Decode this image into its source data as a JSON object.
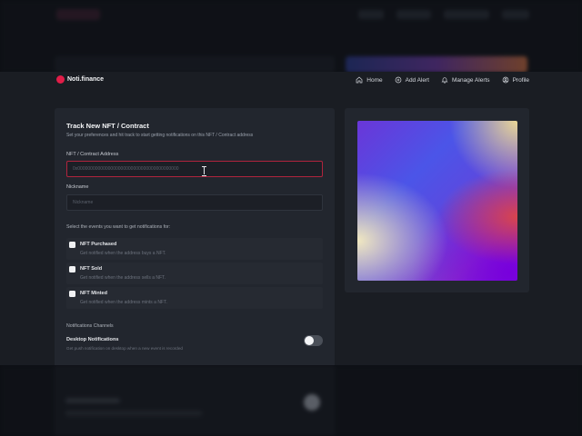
{
  "brand": {
    "name": "Noti.finance"
  },
  "nav": [
    {
      "label": "Home",
      "icon": "home-icon"
    },
    {
      "label": "Add Alert",
      "icon": "plus-circle-icon"
    },
    {
      "label": "Manage Alerts",
      "icon": "bell-icon"
    },
    {
      "label": "Profile",
      "icon": "user-circle-icon"
    }
  ],
  "form": {
    "title": "Track New NFT / Contract",
    "subtitle": "Set your preferences and hit track to start getting notifications on this NFT / Contract address",
    "address_label": "NFT / Contract Address",
    "address_placeholder": "0x0000000000000000000000000000000000000000",
    "nickname_label": "Nickname",
    "nickname_placeholder": "Nickname",
    "events_label": "Select the events you want to get notifications for:",
    "events": [
      {
        "title": "NFT Purchased",
        "description": "Get notified when the address buys a NFT.",
        "checked": false
      },
      {
        "title": "NFT Sold",
        "description": "Get notified when the address sells a NFT.",
        "checked": false
      },
      {
        "title": "NFT Minted",
        "description": "Get notified when the address mints a NFT.",
        "checked": false
      }
    ],
    "channels_label": "Notifications Channels",
    "desktop": {
      "title": "Desktop Notifications",
      "description": "Get push notification on desktop when a new event is recorded",
      "enabled": false
    }
  },
  "colors": {
    "brand_accent": "#e11d48",
    "focus_border": "#b0243d",
    "card_bg": "#22262e",
    "page_bg": "#1a1d23"
  }
}
